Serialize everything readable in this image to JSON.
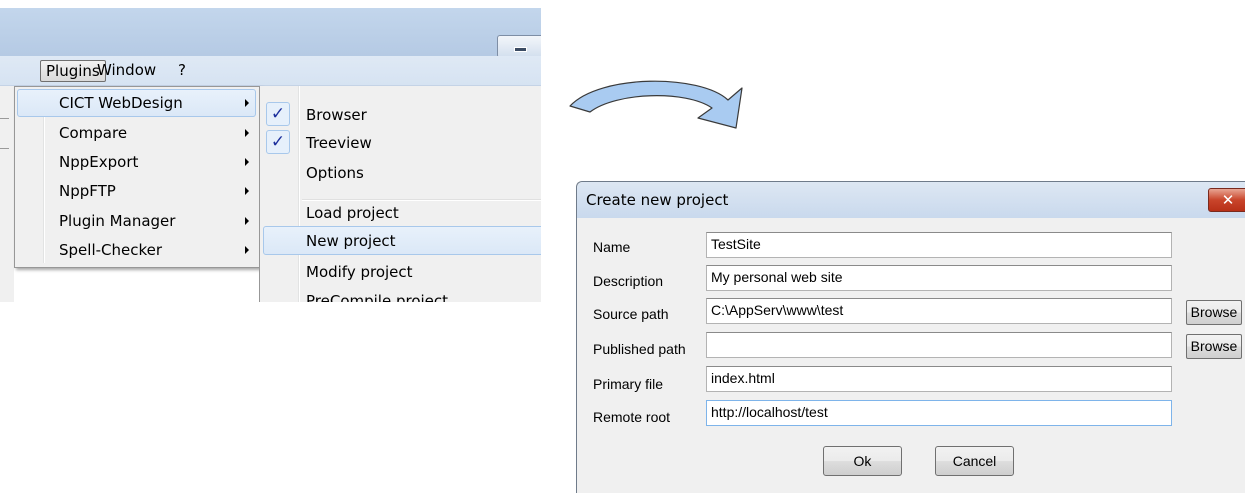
{
  "npp": {
    "menubar": [
      "Plugins",
      "Window",
      "?"
    ],
    "plugins_menu": [
      "CICT WebDesign",
      "Compare",
      "NppExport",
      "NppFTP",
      "Plugin Manager",
      "Spell-Checker"
    ],
    "submenu": {
      "checked_items": [
        "Browser",
        "Treeview"
      ],
      "items": [
        "Options",
        "Load project",
        "New project",
        "Modify project",
        "PreCompile project"
      ]
    }
  },
  "dialog": {
    "title": "Create new project",
    "close_glyph": "✕",
    "fields": [
      {
        "label": "Name",
        "value": "TestSite"
      },
      {
        "label": "Description",
        "value": "My personal web site"
      },
      {
        "label": "Source path",
        "value": "C:\\AppServ\\www\\test"
      },
      {
        "label": "Published path",
        "value": ""
      },
      {
        "label": "Primary file",
        "value": "index.html"
      },
      {
        "label": "Remote root",
        "value": "http://localhost/test"
      }
    ],
    "browse_label": "Browse",
    "ok_label": "Ok",
    "cancel_label": "Cancel"
  },
  "colors": {
    "highlight": "#dbe8f7",
    "arrow_fill": "#a9cbf1",
    "close_red": "#c9452b"
  },
  "icons": [
    "minimize-icon",
    "submenu-arrow-icon",
    "checkmark-icon",
    "close-icon",
    "curved-arrow-icon"
  ]
}
